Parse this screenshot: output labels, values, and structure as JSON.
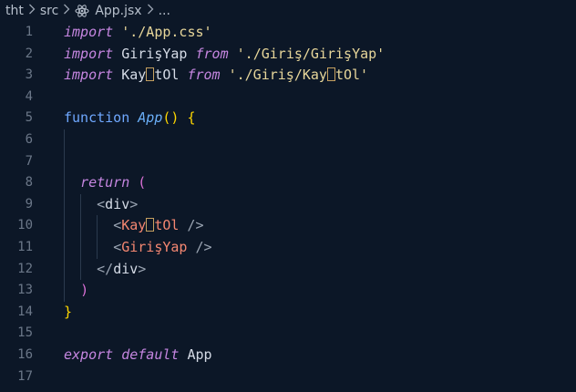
{
  "breadcrumb": {
    "items": [
      "tht",
      "src",
      "App.jsx",
      "..."
    ],
    "file_icon": "react-icon",
    "separator_icon": "chevron-right-icon"
  },
  "line_numbers": [
    "1",
    "2",
    "3",
    "4",
    "5",
    "6",
    "7",
    "8",
    "9",
    "10",
    "11",
    "12",
    "13",
    "14",
    "15",
    "16",
    "17"
  ],
  "code": {
    "l1": {
      "kw": "import",
      "str": "'./App.css'"
    },
    "l2": {
      "kw": "import",
      "name": "GirişYap",
      "from": "from",
      "str": "'./Giriş/GirişYap'"
    },
    "l3": {
      "kw": "import",
      "name_a": "Kay",
      "name_b": "tOl",
      "from": "from",
      "str_a": "'./Giriş/Kay",
      "str_b": "tOl'"
    },
    "l5": {
      "kw": "function",
      "fn": "App",
      "paren": "()",
      "brace": "{"
    },
    "l8": {
      "kw": "return",
      "paren": "("
    },
    "l9": {
      "open": "<",
      "tag": "div",
      "close": ">"
    },
    "l10": {
      "open": "<",
      "comp_a": "Kay",
      "comp_b": "tOl",
      "close": " />"
    },
    "l11": {
      "open": "<",
      "comp": "GirişYap",
      "close": " />"
    },
    "l12": {
      "open": "</",
      "tag": "div",
      "close": ">"
    },
    "l13": {
      "paren": ")"
    },
    "l14": {
      "brace": "}"
    },
    "l16": {
      "kw1": "export",
      "kw2": "default",
      "name": "App"
    }
  },
  "colors": {
    "background": "#0c1727",
    "keyword_italic": "#c586e0",
    "string": "#e7d69a",
    "tag": "#4ec9b0",
    "component": "#f48771",
    "bracket_gold": "#ffd700",
    "bracket_pink": "#da70d6"
  }
}
